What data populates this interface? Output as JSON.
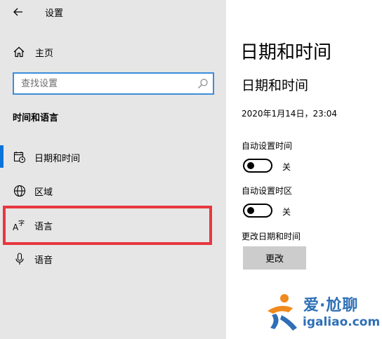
{
  "header": {
    "title": "设置",
    "back_icon": "back-arrow-icon"
  },
  "sidebar": {
    "home_label": "主页",
    "search_placeholder": "查找设置",
    "section_title": "时间和语言",
    "items": [
      {
        "label": "日期和时间",
        "icon": "calendar-clock-icon",
        "selected": true
      },
      {
        "label": "区域",
        "icon": "globe-icon",
        "selected": false
      },
      {
        "label": "语言",
        "icon": "language-icon",
        "selected": false
      },
      {
        "label": "语音",
        "icon": "microphone-icon",
        "selected": false
      }
    ],
    "highlighted_item": "语言"
  },
  "main": {
    "page_title": "日期和时间",
    "sub_title": "日期和时间",
    "current_datetime": "2020年1月14日，23:04",
    "auto_time": {
      "label": "自动设置时间",
      "state": "关",
      "on": false
    },
    "auto_timezone": {
      "label": "自动设置时区",
      "state": "关",
      "on": false
    },
    "change_section_label": "更改日期和时间",
    "change_button_label": "更改"
  },
  "watermark": {
    "text": "爱·尬聊",
    "url": "igaliao.com"
  },
  "colors": {
    "sidebar_bg": "#e6e6e6",
    "accent": "#0a74d9",
    "search_border": "#3c8ddb",
    "highlight": "#e8373f",
    "button_bg": "#cccccc",
    "watermark": "#2e6fb6"
  }
}
